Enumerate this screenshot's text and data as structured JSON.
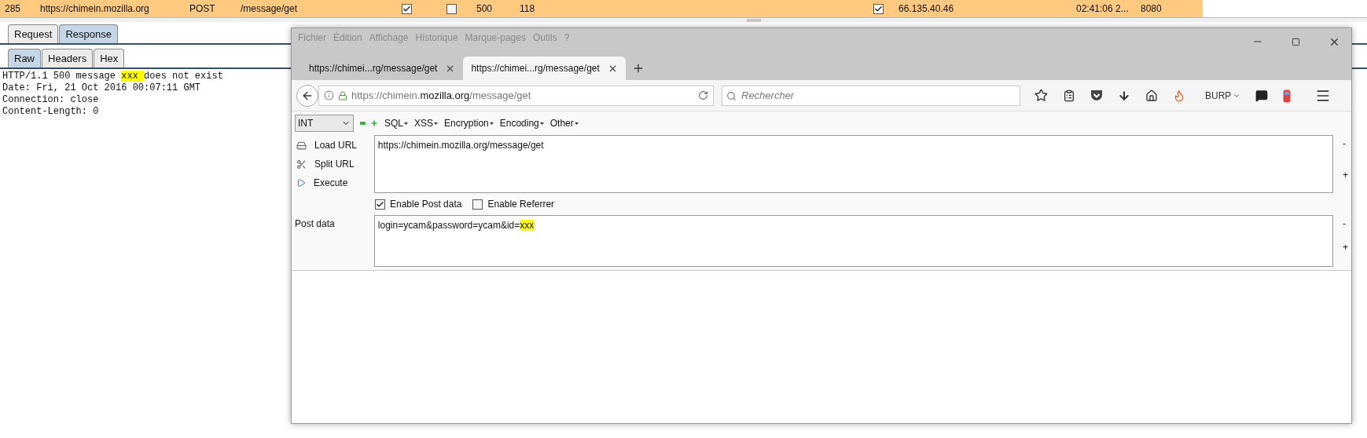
{
  "history_row": {
    "selected": true,
    "cells": [
      {
        "kind": "text",
        "text": "285"
      },
      {
        "kind": "text",
        "text": "https://chimein.mozilla.org"
      },
      {
        "kind": "text",
        "text": "POST"
      },
      {
        "kind": "text",
        "text": "/message/get"
      },
      {
        "kind": "checkbox",
        "checked": true
      },
      {
        "kind": "checkbox",
        "checked": false
      },
      {
        "kind": "text",
        "text": "500"
      },
      {
        "kind": "text",
        "text": "118"
      },
      {
        "kind": "checkbox",
        "checked": true
      },
      {
        "kind": "text",
        "text": "66.135.40.46"
      },
      {
        "kind": "text",
        "text": "02:41:06 2..."
      },
      {
        "kind": "text",
        "text": "8080"
      }
    ]
  },
  "message_tabs": [
    {
      "label": "Request",
      "selected": false
    },
    {
      "label": "Response",
      "selected": true
    }
  ],
  "view_tabs": [
    {
      "label": "Raw",
      "selected": true
    },
    {
      "label": "Headers",
      "selected": false
    },
    {
      "label": "Hex",
      "selected": false
    }
  ],
  "response_lines": [
    {
      "segments": [
        {
          "text": "HTTP/1.1 500 message ",
          "highlighted": false
        },
        {
          "text": "xxx ",
          "highlighted": true
        },
        {
          "text": "does not exist",
          "highlighted": false
        }
      ]
    },
    {
      "segments": [
        {
          "text": "Date: Fri, 21 Oct 2016 00:07:11 GMT",
          "highlighted": false
        }
      ]
    },
    {
      "segments": [
        {
          "text": "Connection: close",
          "highlighted": false
        }
      ]
    },
    {
      "segments": [
        {
          "text": "Content-Length: 0",
          "highlighted": false
        }
      ]
    }
  ],
  "browser": {
    "menu": [
      "Fichier",
      "Édition",
      "Affichage",
      "Historique",
      "Marque-pages",
      "Outils",
      "?"
    ],
    "tabs": [
      {
        "label": "https://chimei...rg/message/get",
        "selected": false
      },
      {
        "label": "https://chimei...rg/message/get",
        "selected": true
      }
    ],
    "address": {
      "prefix": "https://chimein.",
      "domain": "mozilla.org",
      "path": "/message/get"
    },
    "search": {
      "placeholder": "Rechercher"
    },
    "burp_label": "BURP",
    "hackbar": {
      "select": "INT",
      "menus": [
        "SQL",
        "XSS",
        "Encryption",
        "Encoding",
        "Other"
      ],
      "actions": [
        {
          "kind": "load",
          "label": "Load URL"
        },
        {
          "kind": "split",
          "label": "Split URL"
        },
        {
          "kind": "execute",
          "label": "Execute"
        }
      ],
      "url_value": "https://chimein.mozilla.org/message/get",
      "options": [
        {
          "label": "Enable Post data",
          "checked": true
        },
        {
          "label": "Enable Referrer",
          "checked": false
        }
      ],
      "post_label": "Post data",
      "post_segments": [
        {
          "text": "login=ycam&password=ycam&id=",
          "highlighted": false
        },
        {
          "text": "xxx",
          "highlighted": true
        }
      ],
      "side_buttons": [
        "-",
        "+"
      ]
    }
  }
}
